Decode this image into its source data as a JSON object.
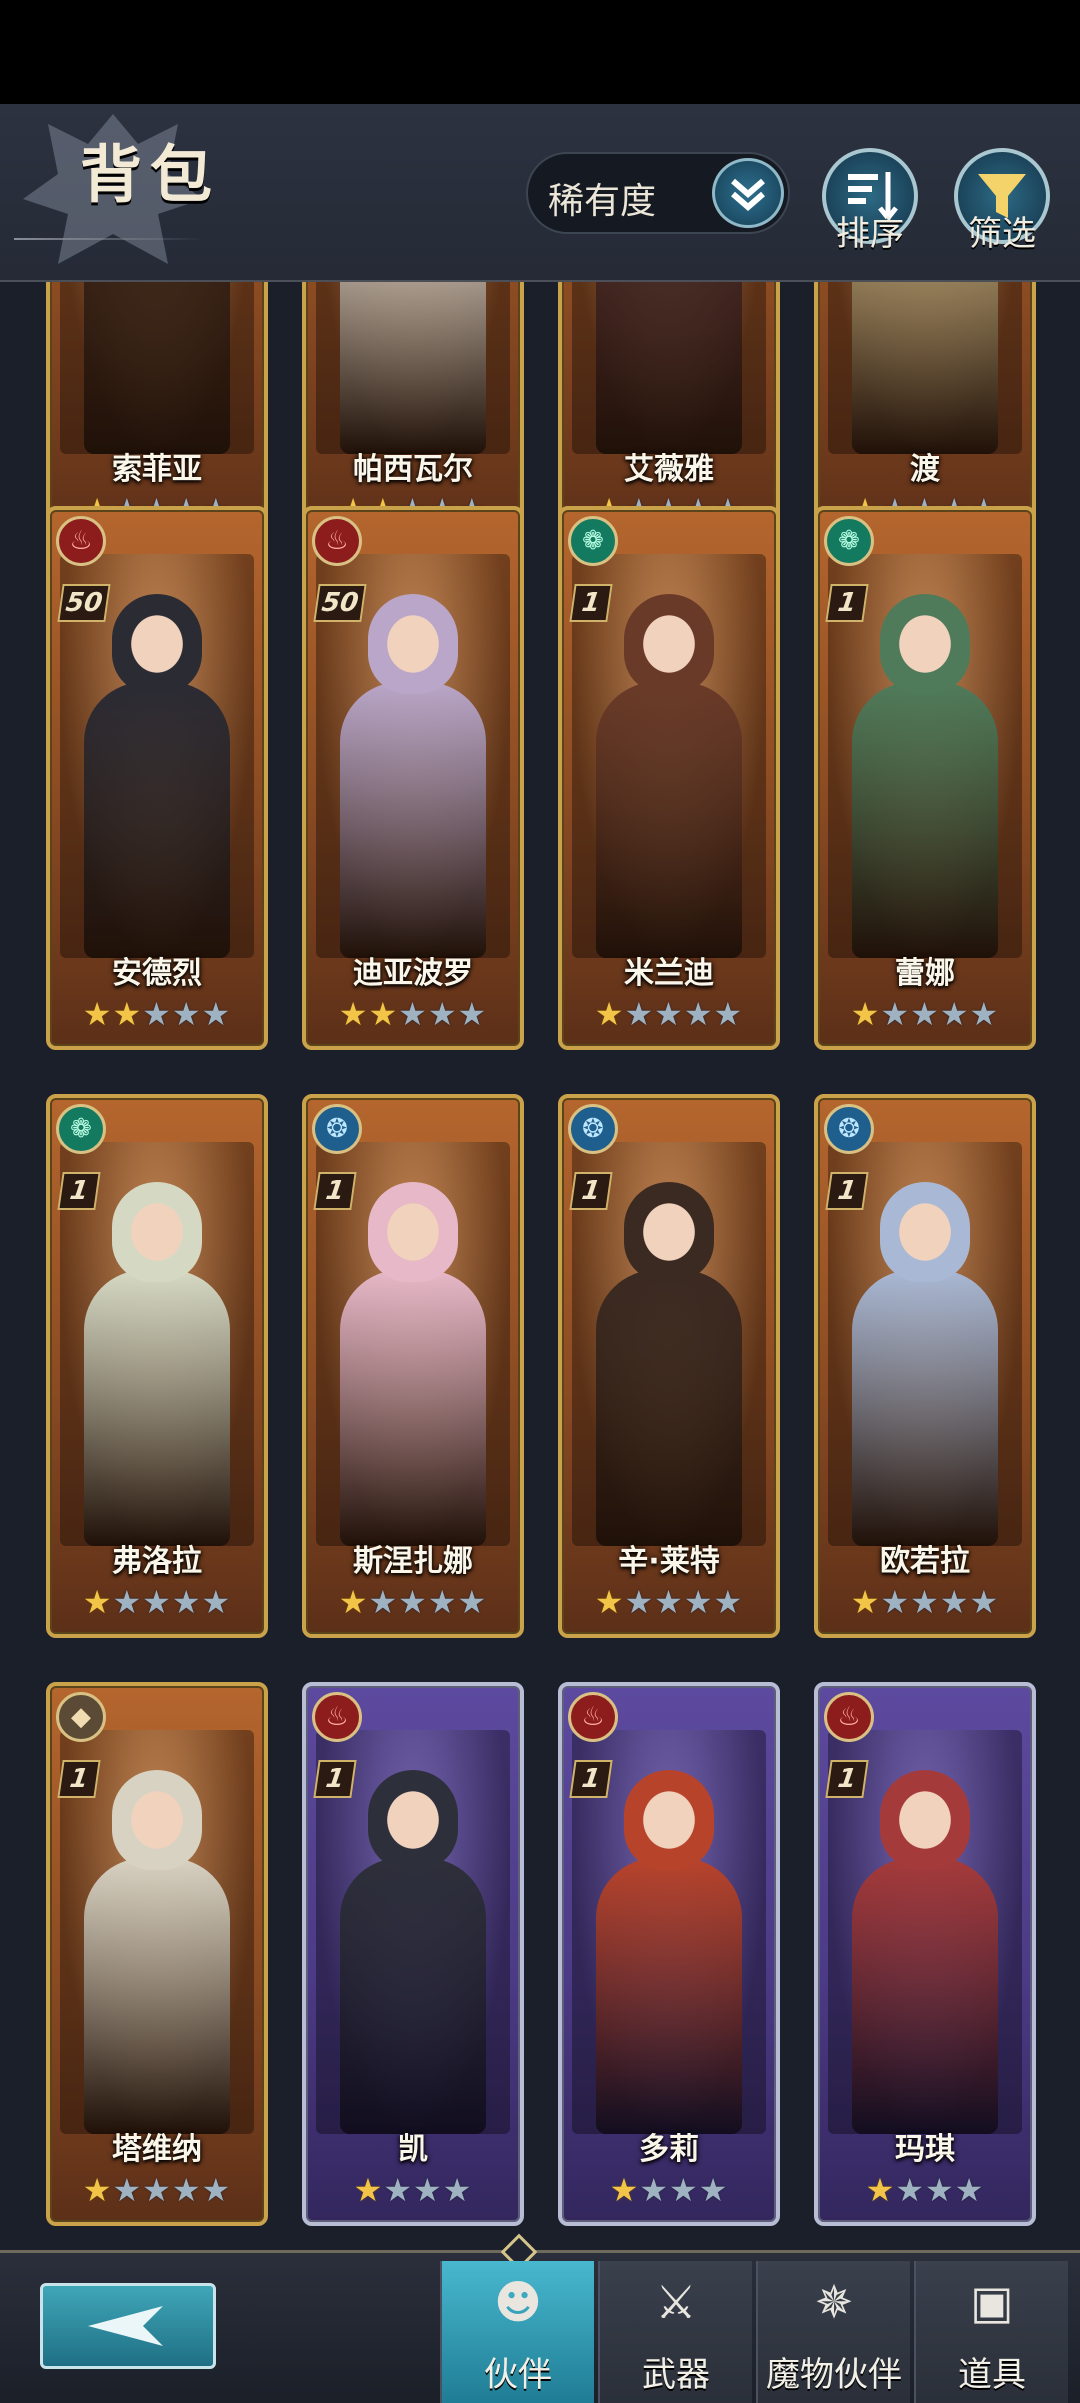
{
  "header": {
    "title": "背包",
    "sort_dropdown_value": "稀有度",
    "sort_button_label": "排序",
    "filter_button_label": "筛选"
  },
  "cards": [
    {
      "name": "索菲亚",
      "stars": 1,
      "max_stars": 5,
      "element": null,
      "level": null,
      "frame": "gold"
    },
    {
      "name": "帕西瓦尔",
      "stars": 2,
      "max_stars": 5,
      "element": null,
      "level": null,
      "frame": "gold"
    },
    {
      "name": "艾薇雅",
      "stars": 1,
      "max_stars": 5,
      "element": null,
      "level": null,
      "frame": "gold"
    },
    {
      "name": "渡",
      "stars": 1,
      "max_stars": 5,
      "element": null,
      "level": null,
      "frame": "gold"
    },
    {
      "name": "安德烈",
      "stars": 2,
      "max_stars": 5,
      "element": "fire",
      "level": "50",
      "frame": "gold"
    },
    {
      "name": "迪亚波罗",
      "stars": 2,
      "max_stars": 5,
      "element": "fire",
      "level": "50",
      "frame": "gold"
    },
    {
      "name": "米兰迪",
      "stars": 1,
      "max_stars": 5,
      "element": "wind",
      "level": "1",
      "frame": "gold"
    },
    {
      "name": "蕾娜",
      "stars": 1,
      "max_stars": 5,
      "element": "wind",
      "level": "1",
      "frame": "gold"
    },
    {
      "name": "弗洛拉",
      "stars": 1,
      "max_stars": 5,
      "element": "wind",
      "level": "1",
      "frame": "gold"
    },
    {
      "name": "斯涅扎娜",
      "stars": 1,
      "max_stars": 5,
      "element": "water",
      "level": "1",
      "frame": "gold"
    },
    {
      "name": "辛·莱特",
      "stars": 1,
      "max_stars": 5,
      "element": "water",
      "level": "1",
      "frame": "gold"
    },
    {
      "name": "欧若拉",
      "stars": 1,
      "max_stars": 5,
      "element": "water",
      "level": "1",
      "frame": "gold"
    },
    {
      "name": "塔维纳",
      "stars": 1,
      "max_stars": 5,
      "element": "earth",
      "level": "1",
      "frame": "gold"
    },
    {
      "name": "凯",
      "stars": 1,
      "max_stars": 4,
      "element": "fire",
      "level": "1",
      "frame": "purple"
    },
    {
      "name": "多莉",
      "stars": 1,
      "max_stars": 4,
      "element": "fire",
      "level": "1",
      "frame": "purple"
    },
    {
      "name": "玛琪",
      "stars": 1,
      "max_stars": 4,
      "element": "fire",
      "level": "1",
      "frame": "purple"
    }
  ],
  "bottom_nav": {
    "tabs": [
      {
        "label": "伙伴",
        "active": true,
        "icon": "bust-icon"
      },
      {
        "label": "武器",
        "active": false,
        "icon": "crossed-swords-icon"
      },
      {
        "label": "魔物伙伴",
        "active": false,
        "icon": "dragon-icon"
      },
      {
        "label": "道具",
        "active": false,
        "icon": "backpack-icon"
      }
    ]
  },
  "colors": {
    "gold_frame": "#c9a24a",
    "purple_frame": "#b7bdd4",
    "accent_teal": "#2f93ad",
    "star_on": "#f2c448",
    "star_off": "#9fb2c2"
  }
}
